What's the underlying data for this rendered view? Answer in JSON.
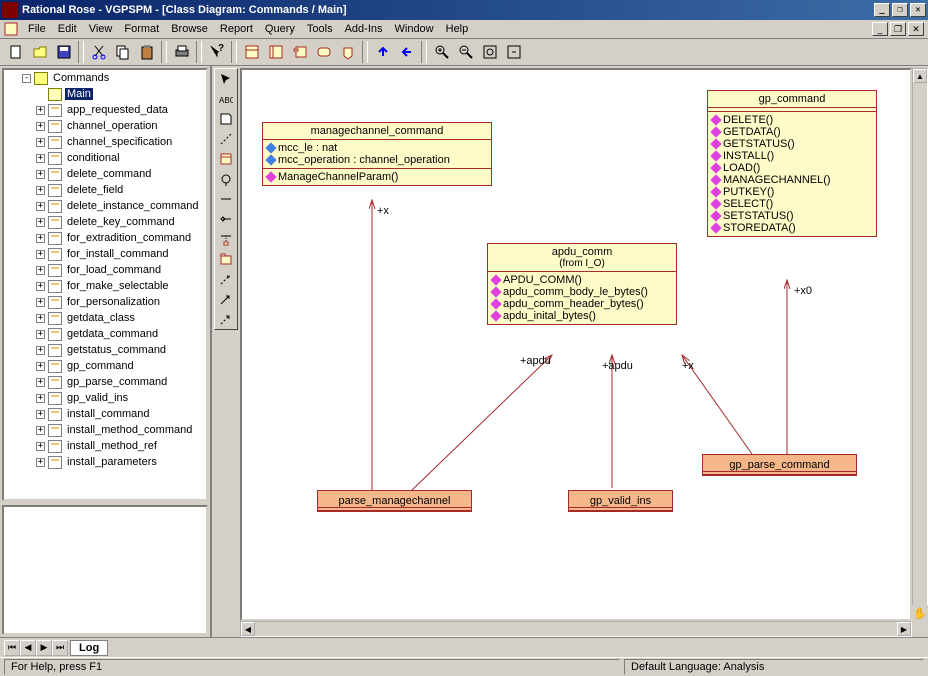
{
  "window": {
    "title": "Rational Rose - VGPSPM - [Class Diagram: Commands / Main]"
  },
  "menus": [
    "File",
    "Edit",
    "View",
    "Format",
    "Browse",
    "Report",
    "Query",
    "Tools",
    "Add-Ins",
    "Window",
    "Help"
  ],
  "tree": {
    "root": "Commands",
    "selected": "Main",
    "items": [
      "app_requested_data",
      "channel_operation",
      "channel_specification",
      "conditional",
      "delete_command",
      "delete_field",
      "delete_instance_command",
      "delete_key_command",
      "for_extradition_command",
      "for_install_command",
      "for_load_command",
      "for_make_selectable",
      "for_personalization",
      "getdata_class",
      "getdata_command",
      "getstatus_command",
      "gp_command",
      "gp_parse_command",
      "gp_valid_ins",
      "install_command",
      "install_method_command",
      "install_method_ref",
      "install_parameters"
    ]
  },
  "classes": {
    "managechannel": {
      "name": "managechannel_command",
      "attrs": [
        "mcc_le : nat",
        "mcc_operation : channel_operation"
      ],
      "ops": [
        "ManageChannelParam()"
      ]
    },
    "apdu": {
      "name": "apdu_comm",
      "from": "(from I_O)",
      "ops": [
        "APDU_COMM()",
        "apdu_comm_body_le_bytes()",
        "apdu_comm_header_bytes()",
        "apdu_inital_bytes()"
      ]
    },
    "gp": {
      "name": "gp_command",
      "ops": [
        "DELETE()",
        "GETDATA()",
        "GETSTATUS()",
        "INSTALL()",
        "LOAD()",
        "MANAGECHANNEL()",
        "PUTKEY()",
        "SELECT()",
        "SETSTATUS()",
        "STOREDATA()"
      ]
    },
    "parse_mc": "parse_managechannel",
    "gp_valid": "gp_valid_ins",
    "gp_parse": "gp_parse_command"
  },
  "labels": {
    "x1": "+x",
    "apdu1": "+apdu",
    "apdu2": "+apdu",
    "x2": "+x",
    "x0": "+x0"
  },
  "log": {
    "tab": "Log"
  },
  "status": {
    "help": "For Help, press F1",
    "lang": "Default Language: Analysis"
  }
}
